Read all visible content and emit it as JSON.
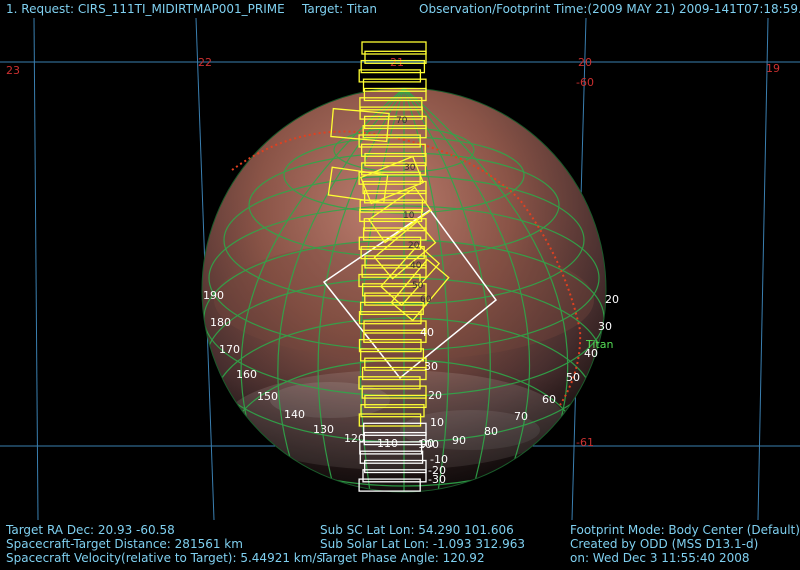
{
  "header": {
    "request": "1. Request: CIRS_111TI_MIDIRTMAP001_PRIME",
    "target": "Target: Titan",
    "obs_time": "Observation/Footprint Time:(2009 MAY 21) 2009-141T07:18:59.62"
  },
  "sky_grid": {
    "ra_labels": [
      "23",
      "22",
      "21",
      "20",
      "19"
    ],
    "dec_labels": [
      "-60",
      "-61"
    ]
  },
  "planet": {
    "name": "Titan",
    "lon_labels": [
      "190",
      "180",
      "170",
      "160",
      "150",
      "140",
      "130",
      "120",
      "110",
      "100"
    ],
    "lat_labels": [
      "20",
      "30",
      "40",
      "50",
      "60",
      "70",
      "80",
      "90"
    ],
    "center_lat_labels": [
      "40",
      "30",
      "20",
      "10",
      "00",
      "-10",
      "-20",
      "-30"
    ],
    "footprint_labels": [
      "10",
      "20",
      "30",
      "40",
      "50",
      "60",
      "70"
    ]
  },
  "footer": {
    "col1": [
      "Target RA Dec: 20.93  -60.58",
      "Spacecraft-Target Distance:  281561 km",
      "Spacecraft Velocity(relative to Target): 5.44921 km/s"
    ],
    "col2": [
      "Sub SC Lat Lon: 54.290  101.606",
      "Sub Solar Lat Lon: -1.093  312.963",
      "Target Phase Angle: 120.92"
    ],
    "col3": [
      "Footprint Mode: Body Center (Default)",
      "Created by ODD (MSS D13.1-d)",
      "on: Wed Dec  3 11:55:40 2008"
    ]
  },
  "colors": {
    "background": "#000000",
    "hud_text": "#7fd0f0",
    "grid_sky": "#3a7fb0",
    "planet_grid": "#2fa84a",
    "footprint": "#ffff33",
    "fov": "#ffffff",
    "terminator": "#e04020"
  }
}
